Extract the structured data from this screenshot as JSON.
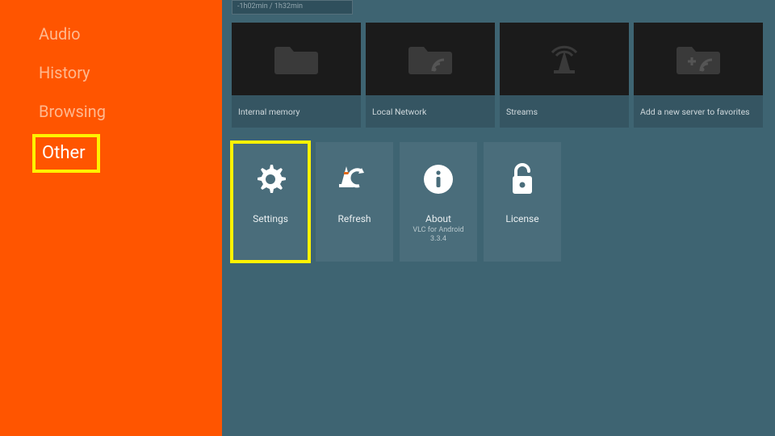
{
  "sidebar": {
    "items": [
      {
        "label": "Audio",
        "selected": false
      },
      {
        "label": "History",
        "selected": false
      },
      {
        "label": "Browsing",
        "selected": false
      },
      {
        "label": "Other",
        "selected": true
      }
    ]
  },
  "video_strip": {
    "caption": "-1h02min / 1h32min"
  },
  "browse_tiles": [
    {
      "label": "Internal memory",
      "icon": "folder"
    },
    {
      "label": "Local Network",
      "icon": "folder-network"
    },
    {
      "label": "Streams",
      "icon": "stream-cone"
    },
    {
      "label": "Add a new server to favorites",
      "icon": "add-server"
    }
  ],
  "other_tiles": [
    {
      "label": "Settings",
      "sub": "",
      "icon": "gear",
      "highlight": true
    },
    {
      "label": "Refresh",
      "sub": "",
      "icon": "refresh",
      "highlight": false
    },
    {
      "label": "About",
      "sub": "VLC for Android\n3.3.4",
      "icon": "info",
      "highlight": false
    },
    {
      "label": "License",
      "sub": "",
      "icon": "lock",
      "highlight": false
    }
  ],
  "colors": {
    "accent": "#ff5500",
    "highlight": "#fff200",
    "panel": "#3e6472",
    "tile": "#4a6d7b",
    "dark": "#1b1b1b"
  }
}
